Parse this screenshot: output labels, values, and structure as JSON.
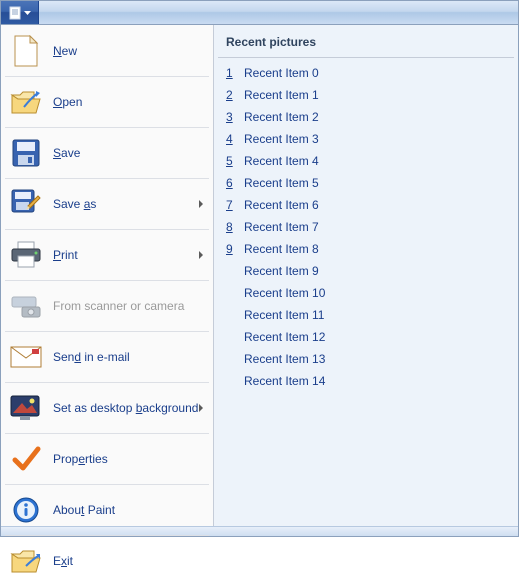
{
  "menu": {
    "new": "New",
    "open": "Open",
    "save": "Save",
    "save_as": "Save as",
    "print": "Print",
    "scanner": "From scanner or camera",
    "email": "Send in e-mail",
    "wallpaper": "Set as desktop background",
    "properties": "Properties",
    "about": "About Paint",
    "exit": "Exit"
  },
  "recent": {
    "header": "Recent pictures",
    "items": [
      {
        "n": "1",
        "label": "Recent Item 0"
      },
      {
        "n": "2",
        "label": "Recent Item 1"
      },
      {
        "n": "3",
        "label": "Recent Item 2"
      },
      {
        "n": "4",
        "label": "Recent Item 3"
      },
      {
        "n": "5",
        "label": "Recent Item 4"
      },
      {
        "n": "6",
        "label": "Recent Item 5"
      },
      {
        "n": "7",
        "label": "Recent Item 6"
      },
      {
        "n": "8",
        "label": "Recent Item 7"
      },
      {
        "n": "9",
        "label": "Recent Item 8"
      },
      {
        "n": "",
        "label": "Recent Item 9"
      },
      {
        "n": "",
        "label": "Recent Item 10"
      },
      {
        "n": "",
        "label": "Recent Item 11"
      },
      {
        "n": "",
        "label": "Recent Item 12"
      },
      {
        "n": "",
        "label": "Recent Item 13"
      },
      {
        "n": "",
        "label": "Recent Item 14"
      }
    ]
  }
}
